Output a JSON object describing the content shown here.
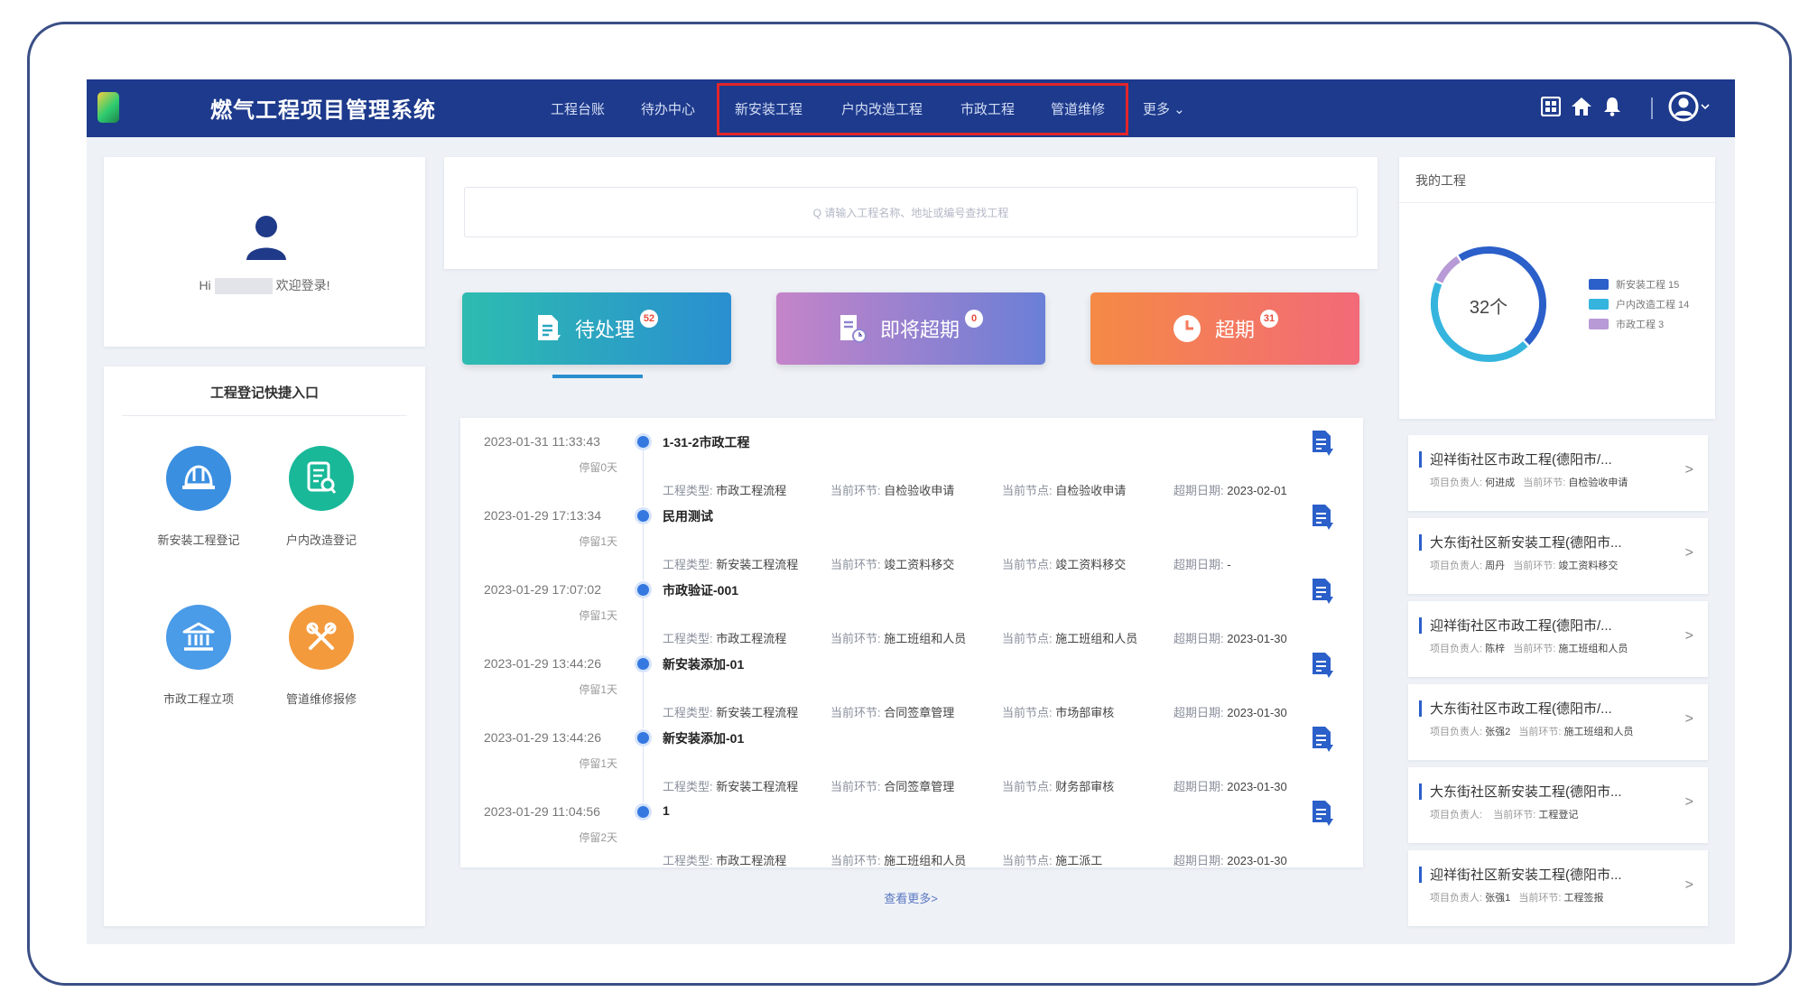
{
  "app": {
    "title": "燃气工程项目管理系统"
  },
  "nav": [
    {
      "label": "工程台账"
    },
    {
      "label": "待办中心"
    },
    {
      "label": "新安装工程"
    },
    {
      "label": "户内改造工程"
    },
    {
      "label": "市政工程"
    },
    {
      "label": "管道维修"
    },
    {
      "label": "更多 ⌄"
    }
  ],
  "header_icons": [
    "grid-icon",
    "home-icon",
    "bell-icon",
    "user-avatar-icon",
    "chevron-down-icon"
  ],
  "user": {
    "greeting": "Hi",
    "welcome": "欢迎登录!"
  },
  "quick": {
    "title": "工程登记快捷入口",
    "items": [
      {
        "label": "新安装工程登记",
        "icon": "helmet-icon",
        "color": "#3a8fe0"
      },
      {
        "label": "户内改造登记",
        "icon": "form-icon",
        "color": "#18b898"
      },
      {
        "label": "市政工程立项",
        "icon": "building-icon",
        "color": "#4a9be8"
      },
      {
        "label": "管道维修报修",
        "icon": "tools-icon",
        "color": "#f39a3c"
      }
    ]
  },
  "search": {
    "placeholder": "Q 请输入工程名称、地址或编号查找工程"
  },
  "tabs": [
    {
      "label": "待处理",
      "count": "52",
      "colors": [
        "#2dbcb0",
        "#2a8fd0"
      ]
    },
    {
      "label": "即将超期",
      "count": "0",
      "colors": [
        "#c584c9",
        "#6a7fd6"
      ]
    },
    {
      "label": "超期",
      "count": "31",
      "colors": [
        "#f58a45",
        "#f26a78"
      ]
    }
  ],
  "list_labels": {
    "type": "工程类型:",
    "step": "当前环节:",
    "node": "当前节点:",
    "deadline": "超期日期:"
  },
  "tasks": [
    {
      "datetime": "2023-01-31 11:33:43",
      "stay": "停留0天",
      "name": "1-31-2市政工程",
      "type": "市政工程流程",
      "step": "自检验收申请",
      "node": "自检验收申请",
      "deadline": "2023-02-01"
    },
    {
      "datetime": "2023-01-29 17:13:34",
      "stay": "停留1天",
      "name": "民用测试",
      "type": "新安装工程流程",
      "step": "竣工资料移交",
      "node": "竣工资料移交",
      "deadline": "-"
    },
    {
      "datetime": "2023-01-29 17:07:02",
      "stay": "停留1天",
      "name": "市政验证-001",
      "type": "市政工程流程",
      "step": "施工班组和人员",
      "node": "施工班组和人员",
      "deadline": "2023-01-30"
    },
    {
      "datetime": "2023-01-29 13:44:26",
      "stay": "停留1天",
      "name": "新安装添加-01",
      "type": "新安装工程流程",
      "step": "合同签章管理",
      "node": "市场部审核",
      "deadline": "2023-01-30"
    },
    {
      "datetime": "2023-01-29 13:44:26",
      "stay": "停留1天",
      "name": "新安装添加-01",
      "type": "新安装工程流程",
      "step": "合同签章管理",
      "node": "财务部审核",
      "deadline": "2023-01-30"
    },
    {
      "datetime": "2023-01-29 11:04:56",
      "stay": "停留2天",
      "name": "1",
      "type": "市政工程流程",
      "step": "施工班组和人员",
      "node": "施工派工",
      "deadline": "2023-01-30"
    }
  ],
  "more_link": "查看更多>",
  "projects": {
    "title": "我的工程",
    "total": "32个",
    "legend": [
      {
        "label": "新安装工程 15",
        "value": 15,
        "color": "#2b5fc9"
      },
      {
        "label": "户内改造工程 14",
        "value": 14,
        "color": "#35b5de"
      },
      {
        "label": "市政工程 3",
        "value": 3,
        "color": "#b89ad6"
      }
    ],
    "owner_label": "项目负责人:",
    "step_label": "当前环节:",
    "items": [
      {
        "title": "迎祥街社区市政工程(德阳市/...",
        "owner": "何进成",
        "step": "自检验收申请"
      },
      {
        "title": "大东街社区新安装工程(德阳市...",
        "owner": "周丹",
        "step": "竣工资料移交"
      },
      {
        "title": "迎祥街社区市政工程(德阳市/...",
        "owner": "陈梓",
        "step": "施工班组和人员"
      },
      {
        "title": "大东街社区市政工程(德阳市/...",
        "owner": "张强2",
        "step": "施工班组和人员"
      },
      {
        "title": "大东街社区新安装工程(德阳市...",
        "owner": "",
        "step": "工程登记"
      },
      {
        "title": "迎祥街社区新安装工程(德阳市...",
        "owner": "张强1",
        "step": "工程签报"
      }
    ]
  }
}
